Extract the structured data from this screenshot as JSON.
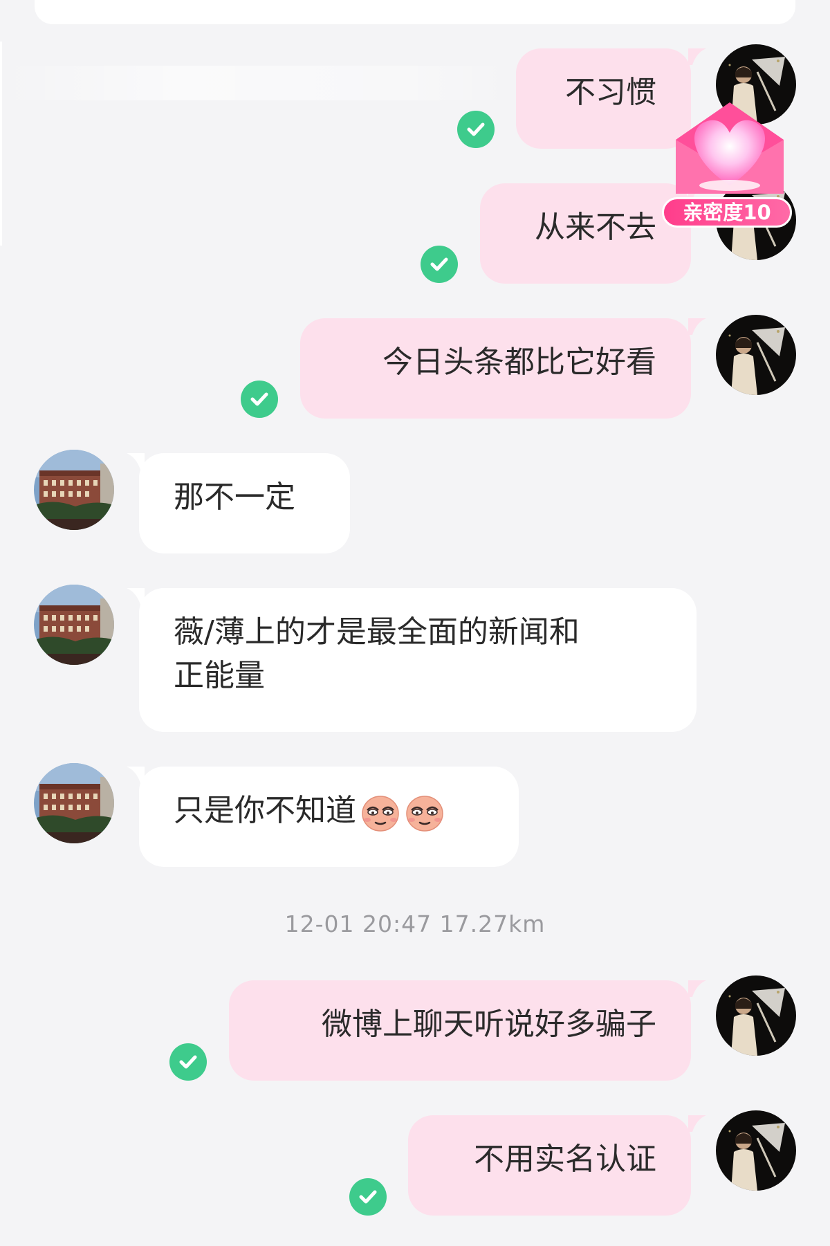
{
  "intimacy_badge": {
    "label": "亲密度10"
  },
  "messages": [
    {
      "side": "sent",
      "text": "不习惯",
      "read": true
    },
    {
      "side": "sent",
      "text": "从来不去",
      "read": true
    },
    {
      "side": "sent",
      "text": "今日头条都比它好看",
      "read": true
    },
    {
      "side": "received",
      "text": "那不一定"
    },
    {
      "side": "received",
      "text_line1": "薇/薄上的才是最全面的新闻和",
      "text_line2": "正能量"
    },
    {
      "side": "received",
      "text": "只是你不知道",
      "emojis": [
        "smirk-emoji",
        "smirk-emoji"
      ]
    },
    {
      "side": "sent",
      "text": "微博上聊天听说好多骗子",
      "read": true
    },
    {
      "side": "sent",
      "text": "不用实名认证",
      "read": true
    }
  ],
  "timestamp": "12-01 20:47   17.27km",
  "colors": {
    "sent_bubble": "#fde0ec",
    "received_bubble": "#ffffff",
    "read_check": "#3ecb8c",
    "badge": "#ff3d8b",
    "background": "#f4f4f6"
  }
}
